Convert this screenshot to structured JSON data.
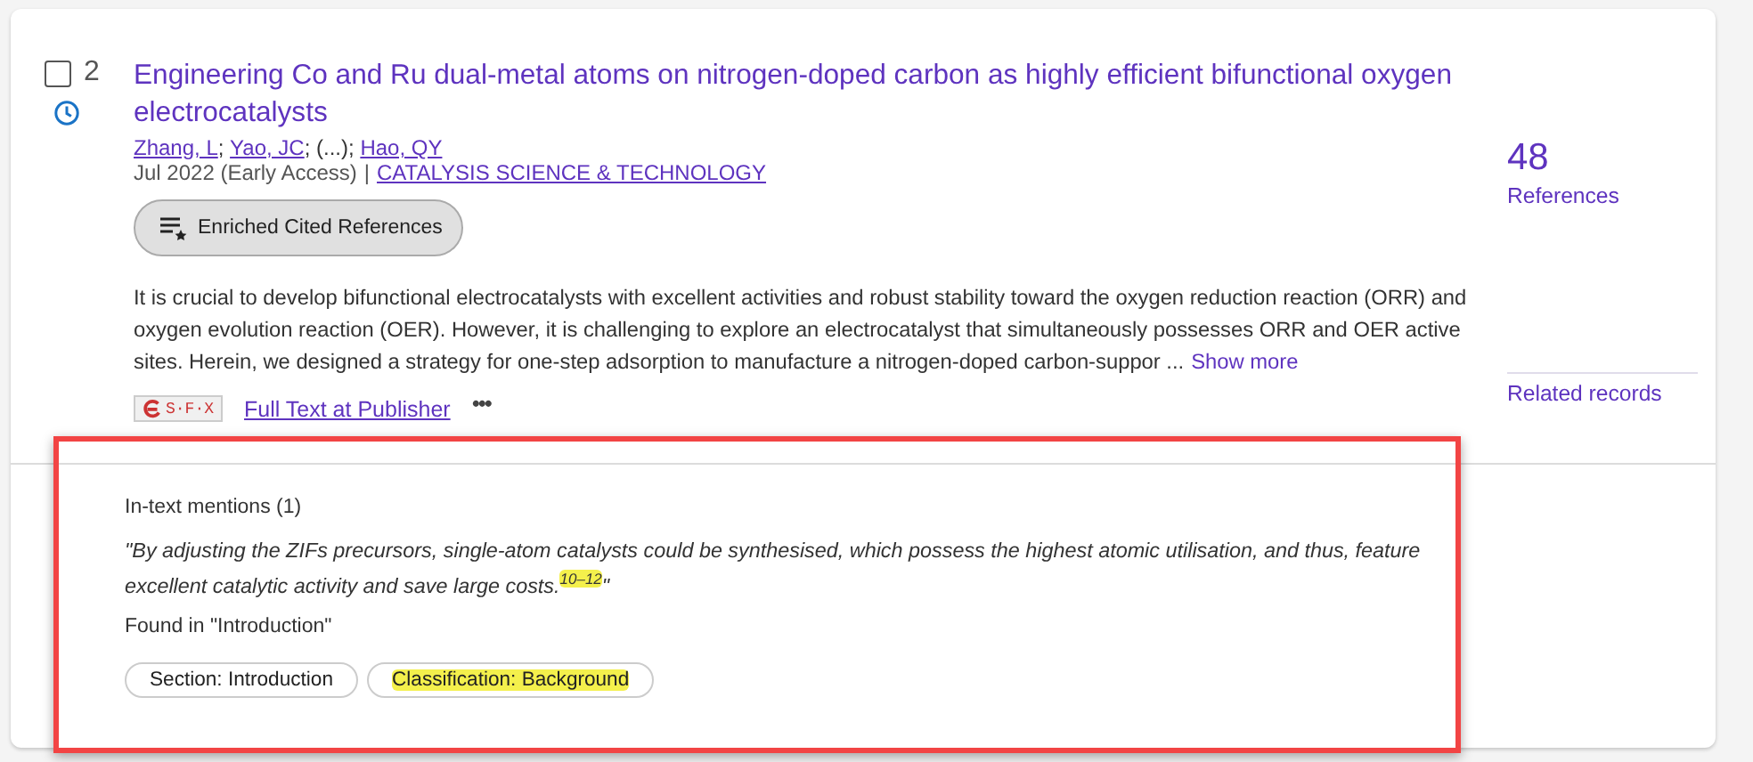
{
  "record": {
    "checked": false,
    "number": "2",
    "title": "Engineering Co and Ru dual-metal atoms on nitrogen-doped carbon as highly efficient bifunctional oxygen electrocatalysts",
    "authors": [
      {
        "name": "Zhang, L"
      },
      {
        "name": "Yao, JC"
      },
      {
        "name": "(...)",
        "kind": "text"
      },
      {
        "name": "Hao, QY"
      }
    ],
    "author_separator": "; ",
    "date": "Jul 2022 (Early Access)",
    "separator": "|",
    "journal": "CATALYSIS SCIENCE & TECHNOLOGY",
    "enriched_button": "Enriched Cited References",
    "abstract": "It is crucial to develop bifunctional electrocatalysts with excellent activities and robust stability toward the oxygen reduction reaction (ORR) and oxygen evolution reaction (OER). However, it is challenging to explore an electrocatalyst that simultaneously possesses ORR and OER active sites. Herein, we designed a strategy for one-step adsorption to manufacture a nitrogen-doped carbon-suppor  ...",
    "show_more": "Show more",
    "sfx_label": "S·F·X",
    "full_text_link": "Full Text at Publisher",
    "more_menu": "•••",
    "references_count": "48",
    "references_label": "References",
    "related_records": "Related records"
  },
  "mentions": {
    "heading": "In-text mentions (1)",
    "quote": "\"By adjusting the ZIFs precursors, single-atom catalysts could be synthesised, which possess the highest atomic utilisation, and thus, feature excellent catalytic activity and save large costs.$^{10–12}$\"",
    "found_in": "Found in \"Introduction\"",
    "tags": [
      {
        "label": "Section: Introduction",
        "highlighted": false
      },
      {
        "label": "Classification: Background",
        "highlighted": true
      }
    ]
  }
}
